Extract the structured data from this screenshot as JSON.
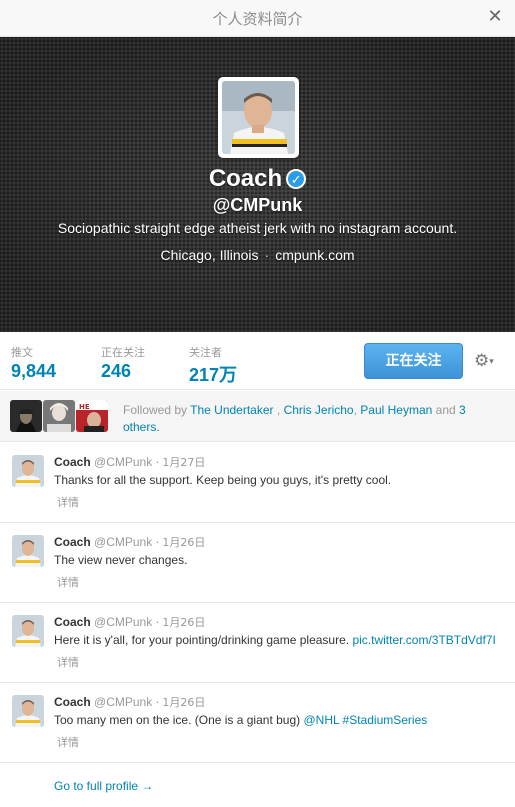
{
  "modal": {
    "title": "个人资料简介",
    "close_icon": "close-icon"
  },
  "profile": {
    "name": "Coach",
    "verified_icon": "verified-badge-icon",
    "verified_glyph": "✓",
    "handle": "@CMPunk",
    "bio": "Sociopathic straight edge atheist jerk with no instagram account.",
    "location": "Chicago, Illinois",
    "separator": "·",
    "url": "cmpunk.com"
  },
  "stats": [
    {
      "label": "推文",
      "value": "9,844"
    },
    {
      "label": "正在关注",
      "value": "246"
    },
    {
      "label": "关注者",
      "value": "217万"
    }
  ],
  "follow_button": {
    "label": "正在关注"
  },
  "gear": {
    "icon": "gear-icon",
    "glyph": "⚙",
    "caret": "▾"
  },
  "followed_by": {
    "prefix": "Followed by",
    "users": [
      "The Undertaker",
      "Chris Jericho",
      "Paul Heyman"
    ],
    "sep1": ",",
    "sep2": ",",
    "and": "and",
    "others": "3 others."
  },
  "tweets": [
    {
      "name": "Coach",
      "handle": "@CMPunk",
      "dot": "·",
      "date": "1月27日",
      "text": "Thanks for all the support. Keep being you guys, it's pretty cool.",
      "link": "",
      "detail": "详情"
    },
    {
      "name": "Coach",
      "handle": "@CMPunk",
      "dot": "·",
      "date": "1月26日",
      "text": "The view never changes.",
      "link": "",
      "detail": "详情"
    },
    {
      "name": "Coach",
      "handle": "@CMPunk",
      "dot": "·",
      "date": "1月26日",
      "text": "Here it is y'all, for your pointing/drinking game pleasure. ",
      "link": "pic.twitter.com/3TBTdVdf7I",
      "detail": "详情"
    },
    {
      "name": "Coach",
      "handle": "@CMPunk",
      "dot": "·",
      "date": "1月26日",
      "text": "Too many men on the ice. (One is a giant bug) ",
      "link": "@NHL #StadiumSeries",
      "detail": "详情"
    }
  ],
  "footer": {
    "full_profile": "Go to full profile →"
  },
  "colors": {
    "link": "#0084b4",
    "follow_button": "#4fa3e0",
    "verified": "#2b9bea"
  }
}
